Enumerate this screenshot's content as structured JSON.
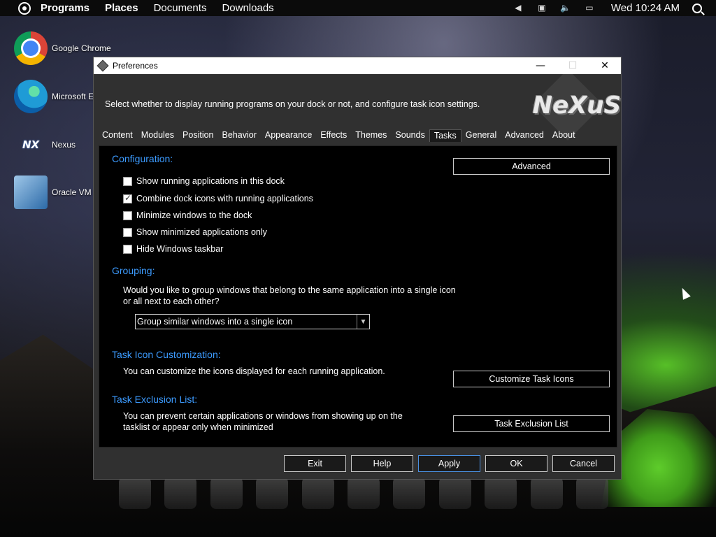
{
  "top_panel": {
    "menu": [
      "Programs",
      "Places",
      "Documents",
      "Downloads"
    ],
    "clock": "Wed 10:24 AM"
  },
  "desktop_icons": [
    {
      "label": "Google Chrome",
      "icon": "chrome-icon"
    },
    {
      "label": "Microsoft E",
      "icon": "edge-icon"
    },
    {
      "label": "Nexus",
      "icon": "nexus-icon"
    },
    {
      "label": "Oracle VM",
      "icon": "virtualbox-icon"
    }
  ],
  "window": {
    "title": "Preferences",
    "description": "Select whether to display running programs on your dock or not, and configure task icon settings.",
    "logo_text": "NeXuS",
    "tabs": [
      "Content",
      "Modules",
      "Position",
      "Behavior",
      "Appearance",
      "Effects",
      "Themes",
      "Sounds",
      "Tasks",
      "General",
      "Advanced",
      "About"
    ],
    "active_tab": "Tasks"
  },
  "configuration": {
    "title": "Configuration:",
    "advanced_button": "Advanced",
    "checkboxes": [
      {
        "label": "Show running applications in this dock",
        "checked": false
      },
      {
        "label": "Combine dock icons with running applications",
        "checked": true
      },
      {
        "label": "Minimize windows to the dock",
        "checked": false
      },
      {
        "label": "Show minimized applications only",
        "checked": false
      },
      {
        "label": "Hide Windows taskbar",
        "checked": false
      }
    ]
  },
  "grouping": {
    "title": "Grouping:",
    "description": "Would you like to group windows that belong to the same application into a single icon or all next to each other?",
    "selected": "Group similar windows into a single icon"
  },
  "task_icon": {
    "title": "Task Icon Customization:",
    "description": "You can customize the icons displayed for each running application.",
    "button": "Customize Task Icons"
  },
  "task_exclusion": {
    "title": "Task Exclusion List:",
    "description": "You can prevent certain applications or windows from showing up on the tasklist or appear only when minimized",
    "button": "Task Exclusion List"
  },
  "footer": {
    "exit": "Exit",
    "help": "Help",
    "apply": "Apply",
    "ok": "OK",
    "cancel": "Cancel"
  },
  "colors": {
    "section_title": "#3c9bff",
    "content_bg": "#000000"
  }
}
